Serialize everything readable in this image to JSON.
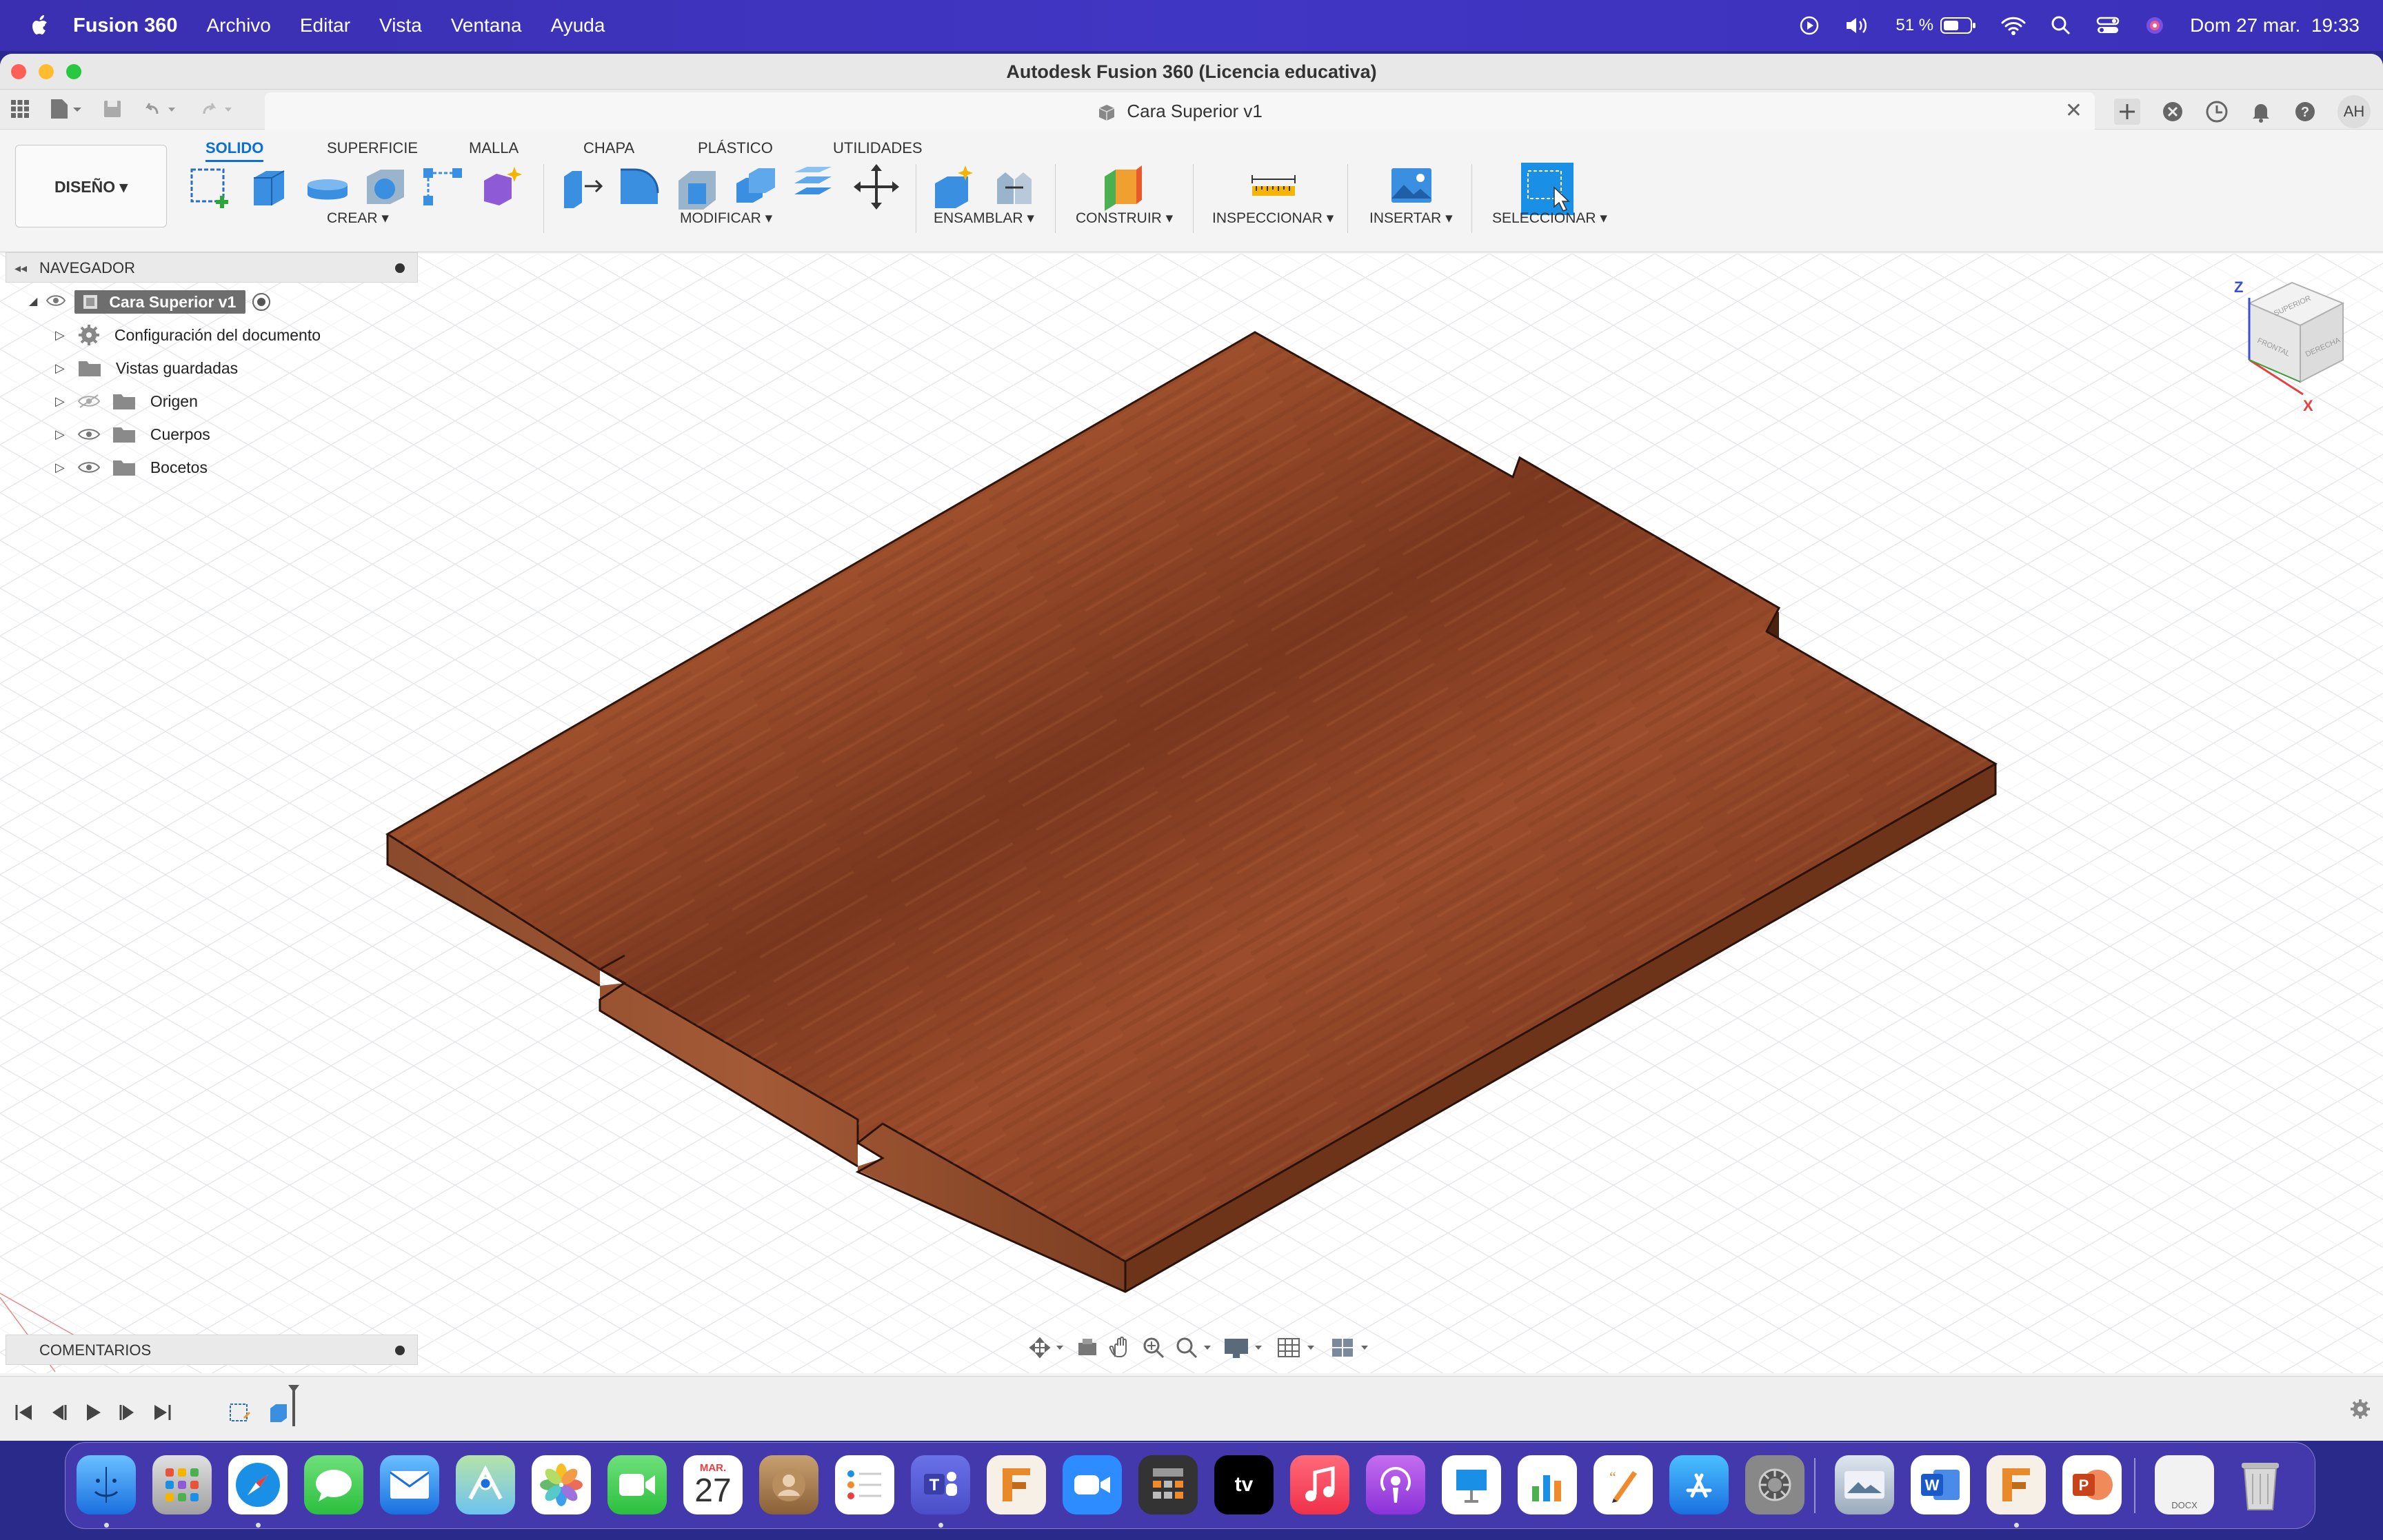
{
  "menubar": {
    "app_name": "Fusion 360",
    "menus": [
      "Archivo",
      "Editar",
      "Vista",
      "Ventana",
      "Ayuda"
    ],
    "battery": "51 %",
    "datetime": "Dom 27 mar.  19:33"
  },
  "window": {
    "title": "Autodesk Fusion 360 (Licencia educativa)",
    "document_tab": "Cara Superior v1",
    "user_initials": "AH"
  },
  "ribbon": {
    "workspace": "DISEÑO ▾",
    "tabs": [
      "SOLIDO",
      "SUPERFICIE",
      "MALLA",
      "CHAPA",
      "PLÁSTICO",
      "UTILIDADES"
    ],
    "active_tab": "SOLIDO",
    "groups": {
      "crear": "CREAR ▾",
      "modificar": "MODIFICAR ▾",
      "ensamblar": "ENSAMBLAR ▾",
      "construir": "CONSTRUIR ▾",
      "inspeccionar": "INSPECCIONAR ▾",
      "insertar": "INSERTAR ▾",
      "seleccionar": "SELECCIONAR ▾"
    }
  },
  "navigator": {
    "header": "NAVEGADOR",
    "root": "Cara Superior v1",
    "items": [
      {
        "label": "Configuración del documento",
        "icon": "gear-icon"
      },
      {
        "label": "Vistas guardadas",
        "icon": "folder-icon"
      },
      {
        "label": "Origen",
        "icon": "folder-icon",
        "visibility": "hidden"
      },
      {
        "label": "Cuerpos",
        "icon": "folder-icon",
        "visibility": "visible"
      },
      {
        "label": "Bocetos",
        "icon": "folder-icon",
        "visibility": "visible"
      }
    ]
  },
  "comments": {
    "header": "COMENTARIOS"
  },
  "viewcube": {
    "axis_z": "Z",
    "axis_x": "X",
    "faces": {
      "top": "SUPERIOR",
      "front": "FRONTAL",
      "right": "DERECHA"
    }
  },
  "dock": {
    "calendar_month": "MAR.",
    "calendar_day": "27",
    "docx_label": "DOCX"
  },
  "colors": {
    "menubar": "#3a2fb0",
    "accent": "#0a6fd6",
    "wood": "#8a3f22"
  }
}
